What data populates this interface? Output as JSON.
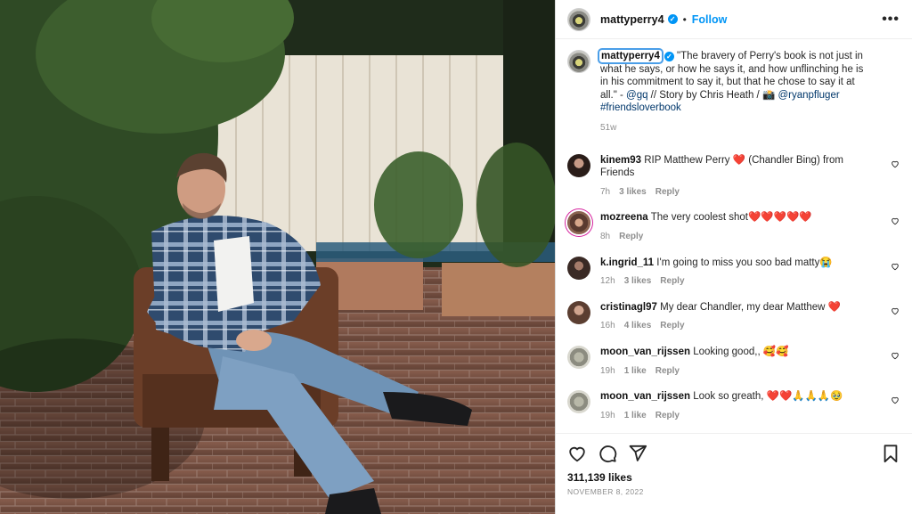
{
  "post": {
    "author": "mattyperry4",
    "follow_label": "Follow",
    "separator": "•",
    "more_label": "•••",
    "caption": {
      "username": "mattyperry4",
      "text": "\"The bravery of Perry's book is not just in what he says, or how he says it, and how unflinching he is in his commitment to say it, but that he chose to say it at all.\" -",
      "mention1": "@gq",
      "text2": " // Story by Chris Heath / 📸 ",
      "mention2": "@ryanpfluger",
      "hashtag": "#friendsloverbook",
      "time": "51w"
    },
    "likes": "311,139 likes",
    "date": "NOVEMBER 8, 2022"
  },
  "comments": [
    {
      "username": "kinem93",
      "text": "RIP Matthew Perry ❤️ (Chandler Bing) from Friends",
      "time": "7h",
      "likes": "3 likes",
      "reply": "Reply"
    },
    {
      "username": "mozreena",
      "text": "The very coolest shot❤️❤️❤️❤️❤️",
      "time": "8h",
      "likes": "",
      "reply": "Reply"
    },
    {
      "username": "k.ingrid_11",
      "text": "I'm going to miss you soo bad matty😭",
      "time": "12h",
      "likes": "3 likes",
      "reply": "Reply"
    },
    {
      "username": "cristinagl97",
      "text": "My dear Chandler, my dear Matthew ❤️",
      "time": "16h",
      "likes": "4 likes",
      "reply": "Reply"
    },
    {
      "username": "moon_van_rijssen",
      "text": "Looking good,, 🥰🥰",
      "time": "19h",
      "likes": "1 like",
      "reply": "Reply"
    },
    {
      "username": "moon_van_rijssen",
      "text": "Look so greath, ❤️❤️🙏🙏🙏🥹",
      "time": "19h",
      "likes": "1 like",
      "reply": "Reply"
    }
  ],
  "icons": {
    "verified": "verified-badge-icon",
    "like": "heart-icon",
    "comment": "comment-bubble-icon",
    "share": "paper-plane-icon",
    "save": "bookmark-icon"
  },
  "colors": {
    "accent": "#0095f6",
    "link": "#00376b",
    "muted": "#8e8e8e"
  }
}
